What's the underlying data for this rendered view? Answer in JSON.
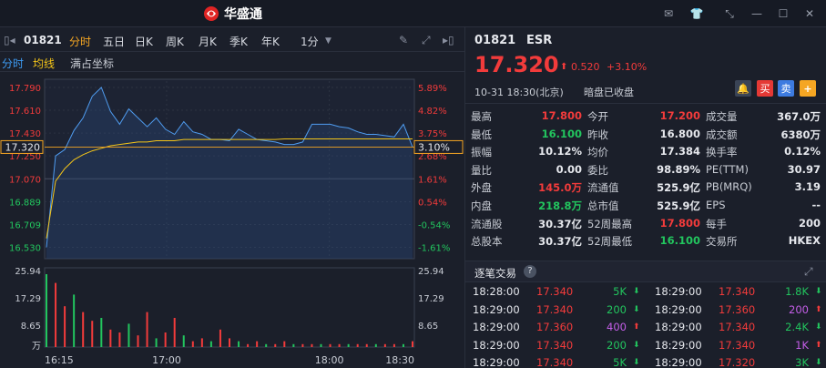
{
  "app": {
    "title": "华盛通"
  },
  "toolbar": {
    "code": "01821",
    "tabs": [
      "分时",
      "五日",
      "日K",
      "周K",
      "月K",
      "季K",
      "年K",
      "1分"
    ]
  },
  "subbar": {
    "items": [
      "分时",
      "均线",
      "满占坐标"
    ]
  },
  "chart_data": {
    "type": "line",
    "left_ticks": [
      "17.790",
      "17.610",
      "17.430",
      "17.250",
      "17.070",
      "16.889",
      "16.709",
      "16.530"
    ],
    "right_ticks": [
      "5.89%",
      "4.82%",
      "3.75%",
      "2.68%",
      "1.61%",
      "0.54%",
      "-0.54%",
      "-1.61%"
    ],
    "price_label": "17.320",
    "pct_label": "3.10%",
    "vol_ticks": [
      "25.94",
      "17.29",
      "8.65",
      "万"
    ],
    "time_ticks": [
      "16:15",
      "17:00",
      "18:00",
      "18:30"
    ],
    "price_series": [
      16.53,
      17.25,
      17.3,
      17.45,
      17.55,
      17.72,
      17.79,
      17.6,
      17.5,
      17.62,
      17.55,
      17.48,
      17.55,
      17.46,
      17.42,
      17.52,
      17.44,
      17.42,
      17.38,
      17.38,
      17.37,
      17.46,
      17.42,
      17.38,
      17.37,
      17.36,
      17.34,
      17.34,
      17.36,
      17.5,
      17.5,
      17.5,
      17.48,
      17.47,
      17.44,
      17.42,
      17.42,
      17.41,
      17.4,
      17.5,
      17.32
    ],
    "avg_series": [
      16.6,
      17.05,
      17.15,
      17.22,
      17.26,
      17.29,
      17.31,
      17.33,
      17.34,
      17.35,
      17.36,
      17.36,
      17.37,
      17.37,
      17.37,
      17.38,
      17.38,
      17.38,
      17.38,
      17.38,
      17.38,
      17.38,
      17.38,
      17.38,
      17.38,
      17.38,
      17.384,
      17.384,
      17.384,
      17.384,
      17.384,
      17.384,
      17.384,
      17.384,
      17.384,
      17.384,
      17.384,
      17.384,
      17.384,
      17.384,
      17.384
    ],
    "volume_series": [
      25,
      22,
      14,
      18,
      12,
      9,
      10,
      6,
      5,
      8,
      4,
      12,
      3,
      5,
      10,
      4,
      2,
      3,
      2,
      6,
      3,
      2,
      1,
      2,
      1,
      1,
      2,
      1,
      1,
      1,
      1,
      1,
      1,
      1,
      1,
      1,
      1,
      1,
      1,
      1,
      2
    ]
  },
  "quote": {
    "code": "01821",
    "name": "ESR",
    "price": "17.320",
    "change": "0.520",
    "change_pct": "+3.10%",
    "datetime": "10-31  18:30(北京)",
    "status": "暗盘已收盘",
    "buttons": {
      "buy": "买",
      "sell": "卖",
      "add": "+"
    }
  },
  "stats": [
    {
      "l1": "最高",
      "v1": "17.800",
      "c1": "red",
      "l2": "今开",
      "v2": "17.200",
      "c2": "red",
      "l3": "成交量",
      "v3": "367.0万",
      "c3": "white"
    },
    {
      "l1": "最低",
      "v1": "16.100",
      "c1": "green",
      "l2": "昨收",
      "v2": "16.800",
      "c2": "white",
      "l3": "成交额",
      "v3": "6380万",
      "c3": "white"
    },
    {
      "l1": "振幅",
      "v1": "10.12%",
      "c1": "white",
      "l2": "均价",
      "v2": "17.384",
      "c2": "white",
      "l3": "换手率",
      "v3": "0.12%",
      "c3": "white"
    },
    {
      "l1": "量比",
      "v1": "0.00",
      "c1": "white",
      "l2": "委比",
      "v2": "98.89%",
      "c2": "white",
      "l3": "PE(TTM)",
      "v3": "30.97",
      "c3": "white"
    },
    {
      "l1": "外盘",
      "v1": "145.0万",
      "c1": "red",
      "l2": "流通值",
      "v2": "525.9亿",
      "c2": "white",
      "l3": "PB(MRQ)",
      "v3": "3.19",
      "c3": "white"
    },
    {
      "l1": "内盘",
      "v1": "218.8万",
      "c1": "green",
      "l2": "总市值",
      "v2": "525.9亿",
      "c2": "white",
      "l3": "EPS",
      "v3": "--",
      "c3": "white"
    },
    {
      "l1": "流通股",
      "v1": "30.37亿",
      "c1": "white",
      "l2": "52周最高",
      "v2": "17.800",
      "c2": "red",
      "l3": "每手",
      "v3": "200",
      "c3": "white"
    },
    {
      "l1": "总股本",
      "v1": "30.37亿",
      "c1": "white",
      "l2": "52周最低",
      "v2": "16.100",
      "c2": "green",
      "l3": "交易所",
      "v3": "HKEX",
      "c3": "white"
    }
  ],
  "trades": {
    "title": "逐笔交易",
    "left": [
      {
        "time": "18:28:00",
        "price": "17.340",
        "qty": "5K",
        "qc": "green",
        "dir": "down"
      },
      {
        "time": "18:29:00",
        "price": "17.340",
        "qty": "200",
        "qc": "green",
        "dir": "down"
      },
      {
        "time": "18:29:00",
        "price": "17.360",
        "qty": "400",
        "qc": "purple",
        "dir": "up"
      },
      {
        "time": "18:29:00",
        "price": "17.340",
        "qty": "200",
        "qc": "green",
        "dir": "down"
      },
      {
        "time": "18:29:00",
        "price": "17.340",
        "qty": "5K",
        "qc": "green",
        "dir": "down"
      }
    ],
    "right": [
      {
        "time": "18:29:00",
        "price": "17.340",
        "qty": "1.8K",
        "qc": "green",
        "dir": "down"
      },
      {
        "time": "18:29:00",
        "price": "17.360",
        "qty": "200",
        "qc": "purple",
        "dir": "up"
      },
      {
        "time": "18:29:00",
        "price": "17.340",
        "qty": "2.4K",
        "qc": "green",
        "dir": "down"
      },
      {
        "time": "18:29:00",
        "price": "17.340",
        "qty": "1K",
        "qc": "purple",
        "dir": "up"
      },
      {
        "time": "18:29:00",
        "price": "17.320",
        "qty": "3K",
        "qc": "green",
        "dir": "down"
      }
    ]
  }
}
